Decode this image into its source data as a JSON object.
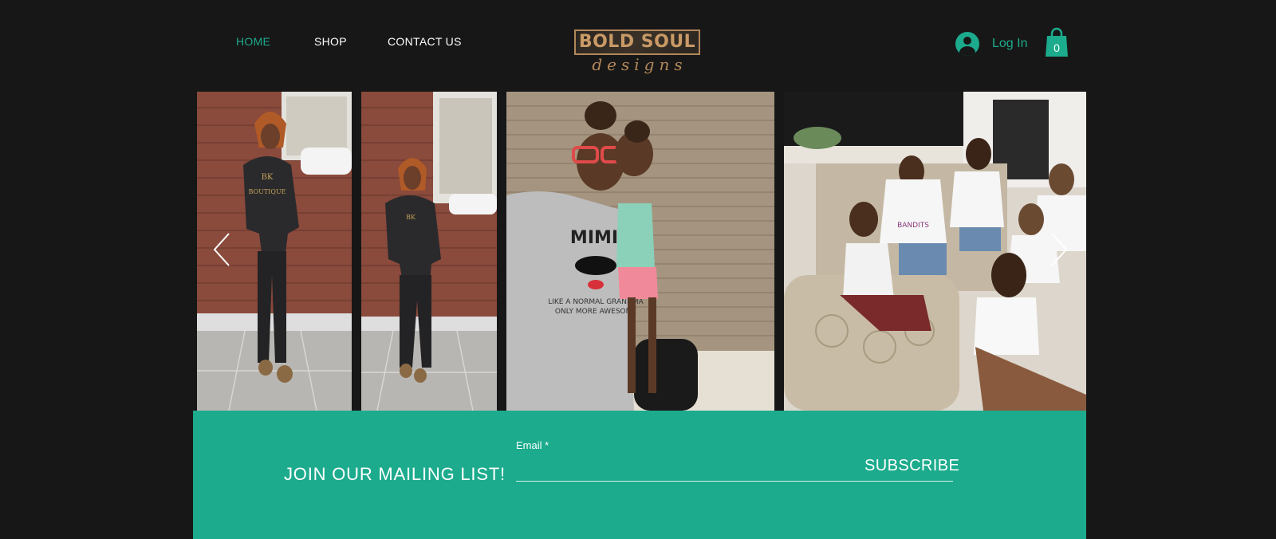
{
  "header": {
    "nav": [
      {
        "label": "HOME",
        "active": true
      },
      {
        "label": "SHOP",
        "active": false
      },
      {
        "label": "CONTACT US",
        "active": false
      }
    ],
    "logo": {
      "main_text": "BOLD SOUL",
      "script_text": "designs"
    },
    "login_label": "Log In",
    "cart_count": "0"
  },
  "gallery": {
    "photos": [
      {
        "name": "woman-black-tracksuit-full"
      },
      {
        "name": "woman-black-tracksuit-far"
      },
      {
        "name": "mimi-and-girl-brick-wall"
      },
      {
        "name": "group-of-women-living-room"
      }
    ],
    "prev_icon": "chevron-left-icon",
    "next_icon": "chevron-right-icon"
  },
  "mailing": {
    "title": "JOIN OUR MAILING LIST!",
    "email_label": "Email *",
    "email_value": "",
    "subscribe_label": "SUBSCRIBE"
  },
  "colors": {
    "background": "#171717",
    "accent": "#1cab8d",
    "logo_gold": "#b3875a"
  }
}
